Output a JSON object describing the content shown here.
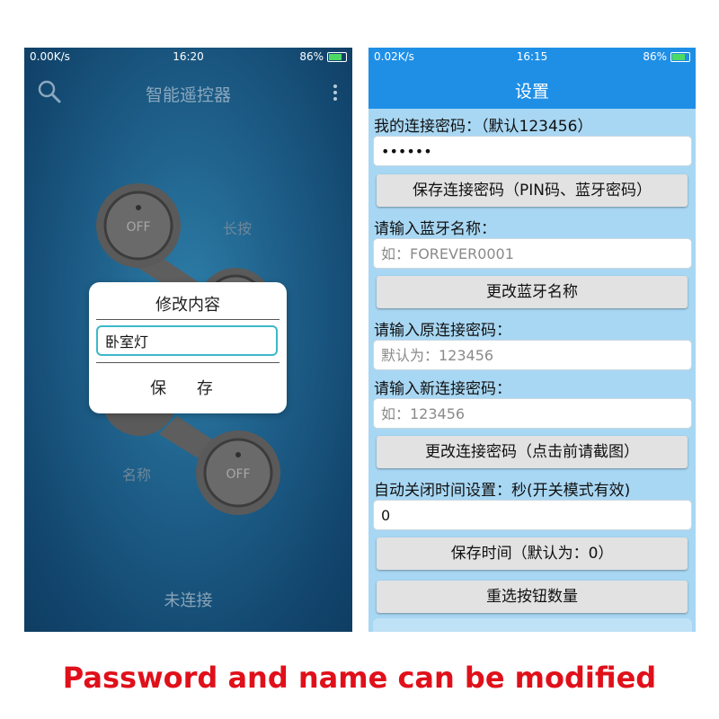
{
  "left": {
    "status": {
      "net": "0.00K/s",
      "time": "16:20",
      "battery": "86%"
    },
    "app_title": "智能遥控器",
    "buttons": {
      "off_top": "OFF",
      "off_bottom": "OFF"
    },
    "hints": {
      "long_press": "长按",
      "name": "名称"
    },
    "connection_status": "未连接",
    "dialog": {
      "title": "修改内容",
      "input_value": "卧室灯",
      "save_label": "保 存"
    }
  },
  "right": {
    "status": {
      "net": "0.02K/s",
      "time": "16:15",
      "battery": "86%"
    },
    "title": "设置",
    "conn_pwd_label": "我的连接密码：（默认123456）",
    "conn_pwd_value": "••••••",
    "save_pwd_button": "保存连接密码（PIN码、蓝牙密码）",
    "bt_name_label": "请输入蓝牙名称：",
    "bt_name_placeholder": "如：FOREVER0001",
    "change_bt_name_button": "更改蓝牙名称",
    "old_pwd_label": "请输入原连接密码：",
    "old_pwd_placeholder": "默认为：123456",
    "new_pwd_label": "请输入新连接密码：",
    "new_pwd_placeholder": "如：123456",
    "change_pwd_button": "更改连接密码（点击前请截图）",
    "auto_off_label": "自动关闭时间设置：秒(开关模式有效)",
    "auto_off_value": "0",
    "save_time_button": "保存时间（默认为：0）",
    "reselect_button": "重选按钮数量"
  },
  "caption": "Password and name can be modified",
  "colors": {
    "accent": "#1f8fe6",
    "caption": "#e0101a",
    "dialog_border": "#3db8c9"
  }
}
